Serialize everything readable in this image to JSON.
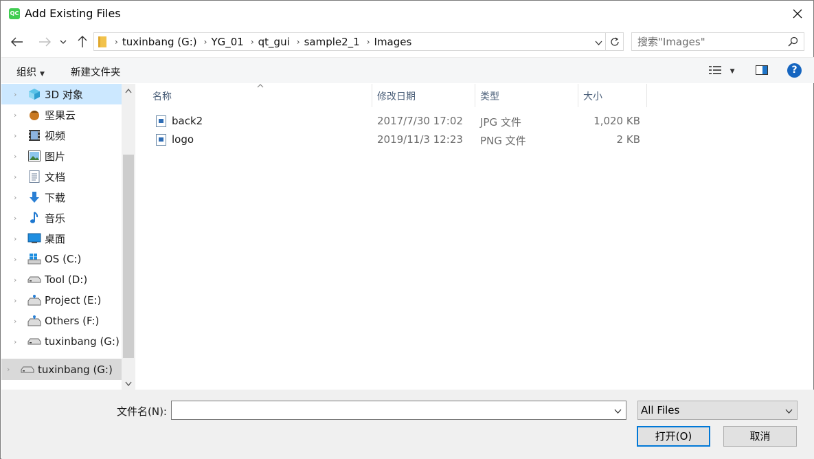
{
  "window": {
    "title": "Add Existing Files",
    "logo_text": "QC"
  },
  "address": {
    "crumbs": [
      "tuxinbang (G:)",
      "YG_01",
      "qt_gui",
      "sample2_1",
      "Images"
    ]
  },
  "search": {
    "placeholder": "搜索\"Images\""
  },
  "toolbar": {
    "organize": "组织",
    "new_folder": "新建文件夹",
    "help": "?"
  },
  "nav": {
    "items": [
      {
        "label": "3D 对象",
        "icon": "3d-objects-icon",
        "selected": true
      },
      {
        "label": "坚果云",
        "icon": "nutstore-icon"
      },
      {
        "label": "视频",
        "icon": "video-icon"
      },
      {
        "label": "图片",
        "icon": "pictures-icon"
      },
      {
        "label": "文档",
        "icon": "documents-icon"
      },
      {
        "label": "下载",
        "icon": "downloads-icon"
      },
      {
        "label": "音乐",
        "icon": "music-icon"
      },
      {
        "label": "桌面",
        "icon": "desktop-icon"
      },
      {
        "label": "OS (C:)",
        "icon": "windows-drive-icon"
      },
      {
        "label": "Tool (D:)",
        "icon": "drive-icon"
      },
      {
        "label": "Project (E:)",
        "icon": "network-drive-icon"
      },
      {
        "label": "Others (F:)",
        "icon": "network-drive-icon"
      },
      {
        "label": "tuxinbang (G:)",
        "icon": "drive-icon"
      }
    ],
    "bottom_item": "tuxinbang (G:)"
  },
  "files": {
    "columns": [
      "名称",
      "修改日期",
      "类型",
      "大小"
    ],
    "rows": [
      {
        "name": "back2",
        "date": "2017/7/30 17:02",
        "type": "JPG 文件",
        "size": "1,020 KB"
      },
      {
        "name": "logo",
        "date": "2019/11/3 12:23",
        "type": "PNG 文件",
        "size": "2 KB"
      }
    ]
  },
  "footer": {
    "filename_label": "文件名(N):",
    "filename_value": "",
    "filter_value": "All Files",
    "open_label": "打开(O)",
    "cancel_label": "取消"
  },
  "colors": {
    "accent": "#0078d7",
    "selection": "#cce8ff",
    "qt_green": "#41cd52"
  }
}
